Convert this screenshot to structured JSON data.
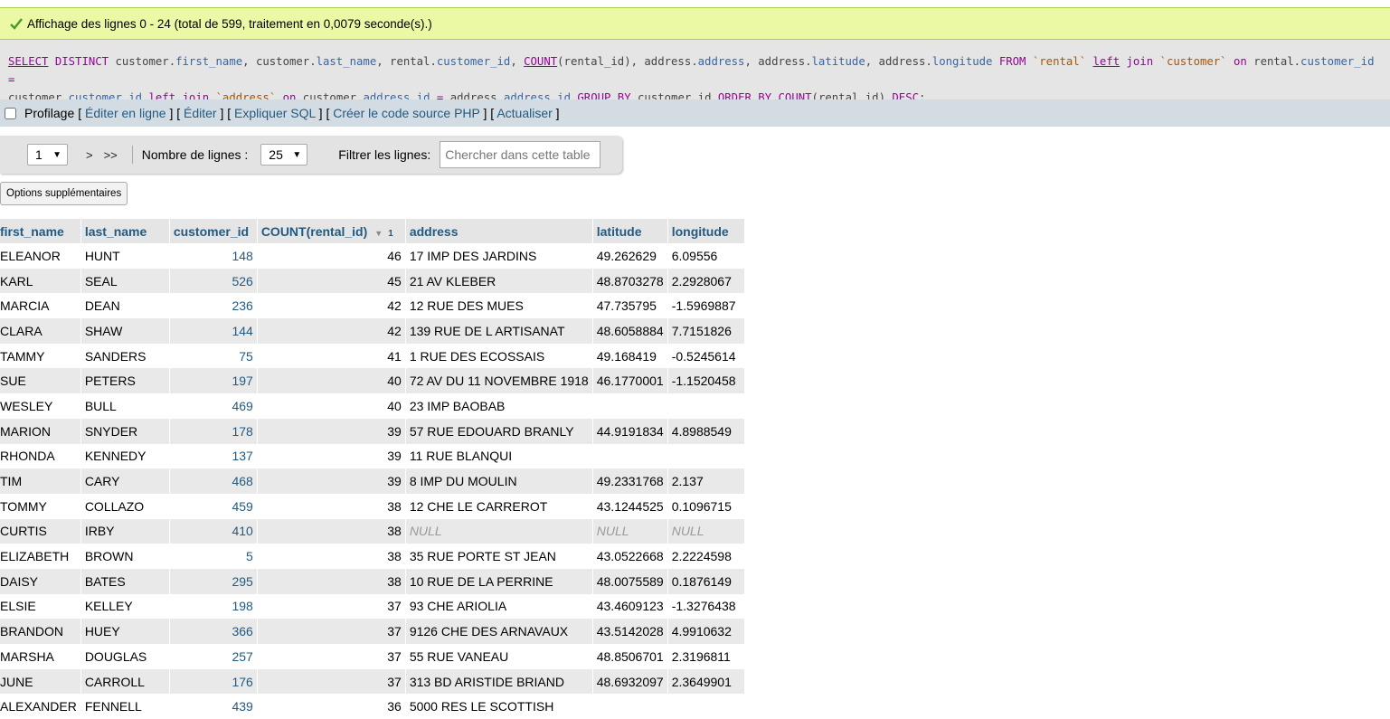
{
  "success_message": "Affichage des lignes 0 - 24 (total de 599, traitement en 0,0079 seconde(s).)",
  "sql": {
    "tokens": [
      {
        "t": "SELECT",
        "c": "kwu"
      },
      {
        "t": " DISTINCT ",
        "c": "kw"
      },
      {
        "t": "customer.",
        "c": "plain"
      },
      {
        "t": "first_name",
        "c": "col"
      },
      {
        "t": ", customer.",
        "c": "plain"
      },
      {
        "t": "last_name",
        "c": "col"
      },
      {
        "t": ", rental.",
        "c": "plain"
      },
      {
        "t": "customer_id",
        "c": "col"
      },
      {
        "t": ", ",
        "c": "plain"
      },
      {
        "t": "COUNT",
        "c": "fn"
      },
      {
        "t": "(rental_id), address.",
        "c": "plain"
      },
      {
        "t": "address",
        "c": "col"
      },
      {
        "t": ", address.",
        "c": "plain"
      },
      {
        "t": "latitude",
        "c": "col"
      },
      {
        "t": ", address.",
        "c": "plain"
      },
      {
        "t": "longitude",
        "c": "col"
      },
      {
        "t": " FROM ",
        "c": "kw"
      },
      {
        "t": "`rental`",
        "c": "str"
      },
      {
        "t": " ",
        "c": "plain"
      },
      {
        "t": "left",
        "c": "kwu"
      },
      {
        "t": " join ",
        "c": "kw"
      },
      {
        "t": "`customer`",
        "c": "str"
      },
      {
        "t": " on ",
        "c": "kw"
      },
      {
        "t": "rental.",
        "c": "plain"
      },
      {
        "t": "customer_id",
        "c": "col"
      },
      {
        "t": " = ",
        "c": "kw"
      },
      {
        "t": "\ncustomer.",
        "c": "plain"
      },
      {
        "t": "customer_id",
        "c": "col"
      },
      {
        "t": " ",
        "c": "plain"
      },
      {
        "t": "left",
        "c": "kwu"
      },
      {
        "t": " join ",
        "c": "kw"
      },
      {
        "t": "`address`",
        "c": "str"
      },
      {
        "t": " on ",
        "c": "kw"
      },
      {
        "t": "customer.",
        "c": "plain"
      },
      {
        "t": "address_id",
        "c": "col"
      },
      {
        "t": " = ",
        "c": "kw"
      },
      {
        "t": "address.",
        "c": "plain"
      },
      {
        "t": "address_id",
        "c": "col"
      },
      {
        "t": " GROUP BY ",
        "c": "kw"
      },
      {
        "t": "customer_id ",
        "c": "plain"
      },
      {
        "t": "ORDER BY ",
        "c": "kw"
      },
      {
        "t": "COUNT",
        "c": "fn"
      },
      {
        "t": "(rental_id) ",
        "c": "plain"
      },
      {
        "t": "DESC",
        "c": "kw"
      },
      {
        "t": ";",
        "c": "plain"
      }
    ]
  },
  "toolbar": {
    "profiling_label": "Profilage",
    "links": [
      "Éditer en ligne",
      "Éditer",
      "Expliquer SQL",
      "Créer le code source PHP",
      "Actualiser"
    ]
  },
  "nav": {
    "page_value": "1",
    "next_label": ">",
    "last_label": ">>",
    "rows_label": "Nombre de lignes :",
    "rows_value": "25",
    "filter_label": "Filtrer les lignes:",
    "filter_placeholder": "Chercher dans cette table"
  },
  "options_button": "Options supplémentaires",
  "table": {
    "headers": [
      "first_name",
      "last_name",
      "customer_id",
      "COUNT(rental_id)",
      "address",
      "latitude",
      "longitude"
    ],
    "sort_index": "1",
    "rows": [
      [
        "ELEANOR",
        "HUNT",
        "148",
        "46",
        "17 IMP DES JARDINS",
        "49.262629",
        "6.09556"
      ],
      [
        "KARL",
        "SEAL",
        "526",
        "45",
        "21 AV KLEBER",
        "48.8703278",
        "2.2928067"
      ],
      [
        "MARCIA",
        "DEAN",
        "236",
        "42",
        "12 RUE DES MUES",
        "47.735795",
        "-1.5969887"
      ],
      [
        "CLARA",
        "SHAW",
        "144",
        "42",
        "139 RUE DE L ARTISANAT",
        "48.6058884",
        "7.7151826"
      ],
      [
        "TAMMY",
        "SANDERS",
        "75",
        "41",
        "1 RUE DES ECOSSAIS",
        "49.168419",
        "-0.5245614"
      ],
      [
        "SUE",
        "PETERS",
        "197",
        "40",
        "72 AV DU 11 NOVEMBRE 1918",
        "46.1770001",
        "-1.1520458"
      ],
      [
        "WESLEY",
        "BULL",
        "469",
        "40",
        "23 IMP BAOBAB",
        "",
        ""
      ],
      [
        "MARION",
        "SNYDER",
        "178",
        "39",
        "57 RUE EDOUARD BRANLY",
        "44.9191834",
        "4.8988549"
      ],
      [
        "RHONDA",
        "KENNEDY",
        "137",
        "39",
        "11 RUE BLANQUI",
        "",
        ""
      ],
      [
        "TIM",
        "CARY",
        "468",
        "39",
        "8 IMP DU MOULIN",
        "49.2331768",
        "2.137"
      ],
      [
        "TOMMY",
        "COLLAZO",
        "459",
        "38",
        "12 CHE LE CARREROT",
        "43.1244525",
        "0.1096715"
      ],
      [
        "CURTIS",
        "IRBY",
        "410",
        "38",
        "NULL",
        "NULL",
        "NULL"
      ],
      [
        "ELIZABETH",
        "BROWN",
        "5",
        "38",
        "35 RUE PORTE ST JEAN",
        "43.0522668",
        "2.2224598"
      ],
      [
        "DAISY",
        "BATES",
        "295",
        "38",
        "10 RUE DE LA PERRINE",
        "48.0075589",
        "0.1876149"
      ],
      [
        "ELSIE",
        "KELLEY",
        "198",
        "37",
        "93 CHE ARIOLIA",
        "43.4609123",
        "-1.3276438"
      ],
      [
        "BRANDON",
        "HUEY",
        "366",
        "37",
        "9126 CHE DES ARNAVAUX",
        "43.5142028",
        "4.9910632"
      ],
      [
        "MARSHA",
        "DOUGLAS",
        "257",
        "37",
        "55 RUE VANEAU",
        "48.8506701",
        "2.3196811"
      ],
      [
        "JUNE",
        "CARROLL",
        "176",
        "37",
        "313 BD ARISTIDE BRIAND",
        "48.6932097",
        "2.3649901"
      ],
      [
        "ALEXANDER",
        "FENNELL",
        "439",
        "36",
        "5000 RES LE SCOTTISH",
        "",
        ""
      ]
    ]
  }
}
